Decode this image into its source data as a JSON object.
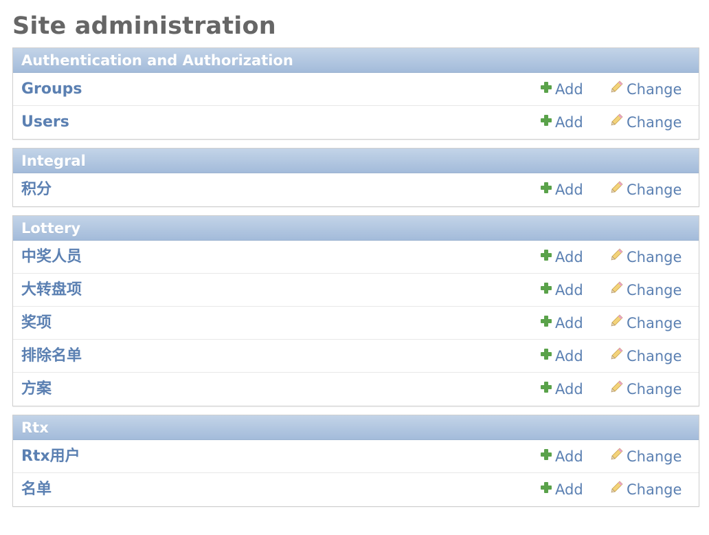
{
  "page": {
    "title": "Site administration"
  },
  "actions": {
    "add_label": "Add",
    "change_label": "Change"
  },
  "icons": {
    "add": "plus-icon",
    "change": "pencil-icon"
  },
  "colors": {
    "link": "#5b80b2",
    "header_top": "#c3d4e8",
    "header_bottom": "#a3bbda",
    "add_icon": "#5aa24a"
  },
  "modules": [
    {
      "name": "Authentication and Authorization",
      "models": [
        "Groups",
        "Users"
      ]
    },
    {
      "name": "Integral",
      "models": [
        "积分"
      ]
    },
    {
      "name": "Lottery",
      "models": [
        "中奖人员",
        "大转盘项",
        "奖项",
        "排除名单",
        "方案"
      ]
    },
    {
      "name": "Rtx",
      "models": [
        "Rtx用户",
        "名单"
      ]
    }
  ]
}
